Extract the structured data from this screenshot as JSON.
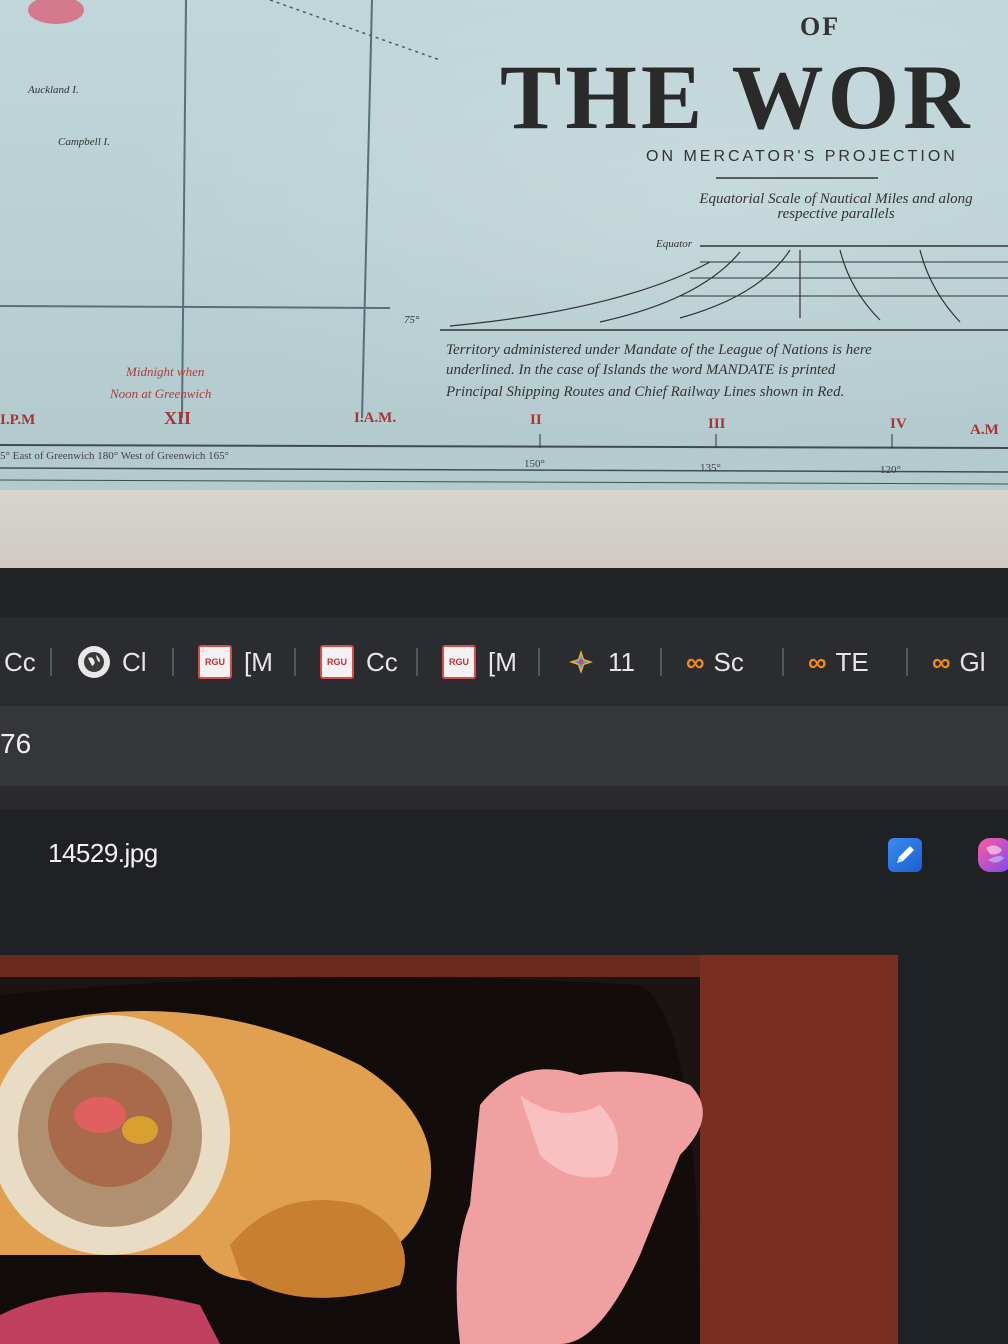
{
  "map": {
    "heading_of": "OF",
    "title": "THE WOR",
    "subtitle": "ON MERCATOR'S PROJECTION",
    "scale_title": "Equatorial Scale of Nautical Miles and along respective parallels",
    "scale_equator": "Equator",
    "legend_line1": "Territory administered under Mandate of the League of Nations is here",
    "legend_line2": "underlined. In the case of Islands the word MANDATE is printed",
    "legend_line3": "Principal Shipping Routes and Chief Railway Lines shown in Red.",
    "islands": [
      "Auckland I.",
      "Campbell I."
    ],
    "midnight_note_1": "Midnight when",
    "midnight_note_2": "Noon at Greenwich",
    "clock_labels": [
      "I.P.M",
      "XII",
      "I.A.M.",
      "II",
      "III",
      "IV",
      "A.M"
    ],
    "longitude_row": "5° East of Greenwich 180° West of Greenwich 165°",
    "longitudes": [
      "150°",
      "135°",
      "120°"
    ],
    "lat_marker": "75°"
  },
  "tabs": [
    {
      "icon": "none",
      "label": "Cc"
    },
    {
      "icon": "globe-icon",
      "label": "Cl"
    },
    {
      "icon": "rgu-icon",
      "label": "[M"
    },
    {
      "icon": "rgu-icon",
      "label": "Cc"
    },
    {
      "icon": "rgu-icon",
      "label": "[M"
    },
    {
      "icon": "star-icon",
      "label": "11"
    },
    {
      "icon": "co-icon",
      "label": "Sc"
    },
    {
      "icon": "co-icon",
      "label": "TE"
    },
    {
      "icon": "co-icon",
      "label": "Gl"
    }
  ],
  "address": {
    "text": "76"
  },
  "viewer": {
    "file_name": "14529.jpg"
  },
  "colors": {
    "accent_orange": "#f08a1a",
    "rgu_red": "#d94b4b",
    "map_blue": "#bcd4d8"
  }
}
